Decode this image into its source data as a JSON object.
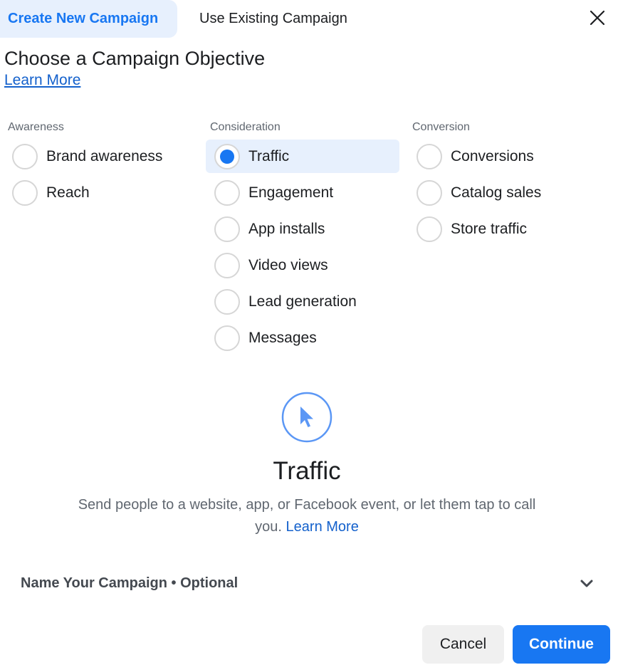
{
  "tabs": [
    {
      "label": "Create New Campaign",
      "active": true
    },
    {
      "label": "Use Existing Campaign",
      "active": false
    }
  ],
  "header": {
    "title": "Choose a Campaign Objective",
    "learn_more": "Learn More",
    "close_icon": "close-icon"
  },
  "columns": [
    {
      "label": "Awareness",
      "options": [
        {
          "label": "Brand awareness",
          "selected": false
        },
        {
          "label": "Reach",
          "selected": false
        }
      ]
    },
    {
      "label": "Consideration",
      "options": [
        {
          "label": "Traffic",
          "selected": true
        },
        {
          "label": "Engagement",
          "selected": false
        },
        {
          "label": "App installs",
          "selected": false
        },
        {
          "label": "Video views",
          "selected": false
        },
        {
          "label": "Lead generation",
          "selected": false
        },
        {
          "label": "Messages",
          "selected": false
        }
      ]
    },
    {
      "label": "Conversion",
      "options": [
        {
          "label": "Conversions",
          "selected": false
        },
        {
          "label": "Catalog sales",
          "selected": false
        },
        {
          "label": "Store traffic",
          "selected": false
        }
      ]
    }
  ],
  "detail": {
    "icon": "cursor-pointer-icon",
    "title": "Traffic",
    "description": "Send people to a website, app, or Facebook event, or let them tap to call you.",
    "learn_more": "Learn More"
  },
  "name_section": {
    "label": "Name Your Campaign • Optional",
    "expand_icon": "chevron-down-icon"
  },
  "footer": {
    "cancel_label": "Cancel",
    "continue_label": "Continue"
  },
  "colors": {
    "accent": "#1877f2",
    "selected_bg": "#e7f0fd",
    "link": "#1461cc"
  }
}
